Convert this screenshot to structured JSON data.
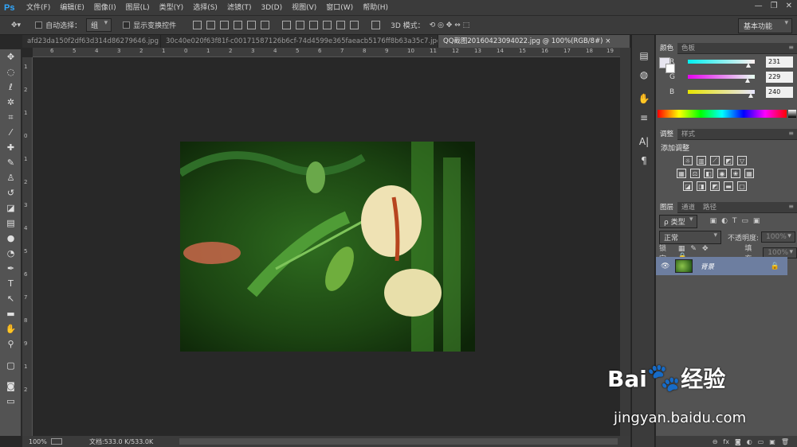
{
  "app": {
    "logo": "Ps"
  },
  "menu": [
    "文件(F)",
    "编辑(E)",
    "图像(I)",
    "图层(L)",
    "类型(Y)",
    "选择(S)",
    "滤镜(T)",
    "3D(D)",
    "视图(V)",
    "窗口(W)",
    "帮助(H)"
  ],
  "window_controls": [
    "—",
    "❐",
    "✕"
  ],
  "options": {
    "auto_select_label": "自动选择：",
    "auto_select_value": "组",
    "show_transform_label": "显示变换控件",
    "mode_3d_label": "3D 模式：",
    "workspace": "基本功能"
  },
  "tabs": [
    {
      "label": "afd23da150f2df63d314d86279646.jpg",
      "active": false
    },
    {
      "label": "30c40e020f63f81f-c00171587126b6cf-74d4599e365faeacb5176ff8b63a35c7.jpg",
      "active": false
    },
    {
      "label": "QQ截图20160423094022.jpg @ 100%(RGB/8#)",
      "active": true,
      "close": "×"
    }
  ],
  "ruler_top": [
    "6",
    "5",
    "4",
    "3",
    "2",
    "1",
    "0",
    "1",
    "2",
    "3",
    "4",
    "5",
    "6",
    "7",
    "8",
    "9",
    "10",
    "11",
    "12",
    "13",
    "14",
    "15",
    "16",
    "17",
    "18",
    "19"
  ],
  "ruler_left": [
    "1",
    "2",
    "1",
    "0",
    "1",
    "2",
    "3",
    "4",
    "5",
    "6",
    "7",
    "8",
    "9",
    "1",
    "2"
  ],
  "status": {
    "zoom": "100%",
    "doc": "文档:533.0 K/533.0K",
    "arrow": "▶"
  },
  "panels": {
    "color": {
      "tabs": [
        "颜色",
        "色板"
      ],
      "channels": [
        {
          "label": "R",
          "value": "231",
          "fraction": 0.906,
          "gradient": "linear-gradient(to right,#00f0f0,#fff0f0)"
        },
        {
          "label": "G",
          "value": "229",
          "fraction": 0.898,
          "gradient": "linear-gradient(to right,#e700f0,#e7fff0)"
        },
        {
          "label": "B",
          "value": "240",
          "fraction": 0.941,
          "gradient": "linear-gradient(to right,#e7e500,#e7e5ff)"
        }
      ]
    },
    "adjustments": {
      "tabs": [
        "调整",
        "样式"
      ],
      "title": "添加调整"
    },
    "layers": {
      "tabs": [
        "图层",
        "通道",
        "路径"
      ],
      "filter": "ρ 类型",
      "blend": "正常",
      "opacity_label": "不透明度:",
      "opacity_value": "100%",
      "lock_label": "锁定:",
      "fill_label": "填充:",
      "fill_value": "100%",
      "layer_name": "背景",
      "footer_icons": [
        "⊖",
        "fx",
        "◙",
        "◐",
        "▭",
        "▣",
        "🗑"
      ]
    }
  },
  "watermark": {
    "brand": "Bai",
    "paw": "🐾",
    "brand2": "经验",
    "url": "jingyan.baidu.com"
  }
}
